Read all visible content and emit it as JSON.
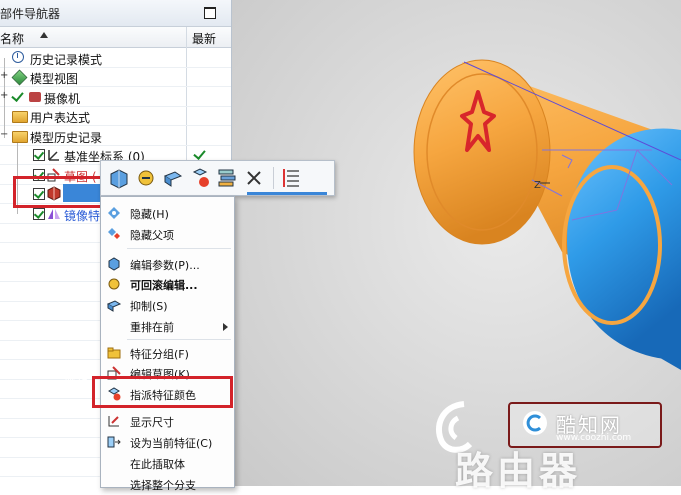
{
  "navigator": {
    "title": "部件导航器",
    "columns": {
      "name": "名称",
      "latest": "最新"
    },
    "tree": [
      {
        "label": "历史记录模式"
      },
      {
        "label": "模型视图"
      },
      {
        "label": "摄像机"
      },
      {
        "label": "用户表达式"
      },
      {
        "label": "模型历史记录"
      },
      {
        "label": "基准坐标系 (0)"
      },
      {
        "label": "草图 ("
      },
      {
        "label": "旋转 (2"
      },
      {
        "label": "镜像特"
      }
    ]
  },
  "context_menu": {
    "items": [
      {
        "label": "隐藏(H)",
        "icon": "hide-icon"
      },
      {
        "label": "隐藏父项",
        "icon": "hide-parents-icon"
      },
      {
        "label": "编辑参数(P)...",
        "icon": "edit-params-icon"
      },
      {
        "label": "可回滚编辑...",
        "icon": "rollback-edit-icon"
      },
      {
        "label": "抑制(S)",
        "icon": "suppress-icon"
      },
      {
        "label": "重排在前",
        "icon": ""
      },
      {
        "label": "特征分组(F)",
        "icon": "folder-icon"
      },
      {
        "label": "编辑草图(K)",
        "icon": "edit-sketch-icon"
      },
      {
        "label": "指派特征颜色",
        "icon": "assign-color-icon"
      },
      {
        "label": "显示尺寸",
        "icon": "show-dimensions-icon"
      },
      {
        "label": "设为当前特征(C)",
        "icon": "make-current-icon"
      },
      {
        "label": "在此插取体",
        "icon": ""
      },
      {
        "label": "选择整个分支",
        "icon": ""
      }
    ]
  },
  "watermark": {
    "title": "酷知网",
    "url": "www.coozhi.com",
    "big": "路由器"
  },
  "colors": {
    "selection": "#3a86d8",
    "highlight_box": "#d3232a",
    "part_orange": "#f6a640",
    "part_blue": "#2f9be8"
  }
}
